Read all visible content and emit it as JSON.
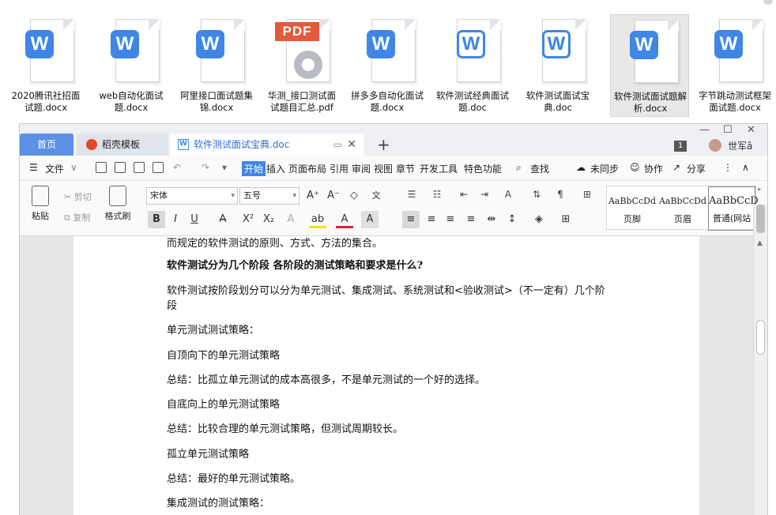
{
  "desktop_files": [
    {
      "label": "2020腾讯社招面试题.docx",
      "kind": "word"
    },
    {
      "label": "web自动化面试题.docx",
      "kind": "word"
    },
    {
      "label": "阿里接口面试题集锦.docx",
      "kind": "word"
    },
    {
      "label": "华测_接口测试面试题目汇总.pdf",
      "kind": "pdf",
      "badge": "PDF"
    },
    {
      "label": "拼多多自动化面试题.docx",
      "kind": "word"
    },
    {
      "label": "软件测试经典面试题.doc",
      "kind": "word-outline"
    },
    {
      "label": "软件测试面试宝典.doc",
      "kind": "word-outline"
    },
    {
      "label": "软件测试面试题解析.docx",
      "kind": "word",
      "selected": true
    },
    {
      "label": "字节跳动测试框架面试题.docx",
      "kind": "word"
    }
  ],
  "window": {
    "tabs": {
      "home": "首页",
      "template": "稻壳模板",
      "document": "软件测试面试宝典.doc"
    },
    "badge_count": "1",
    "user_name": "世军â"
  },
  "menubar": {
    "file": "文件",
    "items": [
      "开始",
      "插入",
      "页面布局",
      "引用",
      "审阅",
      "视图",
      "章节",
      "开发工具",
      "特色功能"
    ],
    "active": "开始",
    "search": "查找",
    "sync": "未同步",
    "collab": "协作",
    "share": "分享"
  },
  "ribbon": {
    "paste": "粘贴",
    "cut": "剪切",
    "copy": "复制",
    "format_painter": "格式刷",
    "font": "宋体",
    "size": "五号",
    "styles": [
      {
        "sample": "AaBbCcDd",
        "name": "页脚"
      },
      {
        "sample": "AaBbCcDd",
        "name": "页眉"
      },
      {
        "sample": "AaBbCcD",
        "name": "普通(网站"
      }
    ]
  },
  "document": {
    "lines": [
      {
        "text": "而规定的软件测试的原则、方式、方法的集合。",
        "style": "body"
      },
      {
        "text": "软件测试分为几个阶段  各阶段的测试策略和要求是什么?",
        "style": "heading"
      },
      {
        "text": "软件测试按阶段划分可以分为单元测试、集成测试、系统测试和<验收测试>（不一定有）几个阶段",
        "style": "wrap"
      },
      {
        "text": "单元测试测试策略：",
        "style": "body"
      },
      {
        "text": "自顶向下的单元测试策略",
        "style": "body"
      },
      {
        "text": "总结：比孤立单元测试的成本高很多，不是单元测试的一个好的选择。",
        "style": "body"
      },
      {
        "text": "自底向上的单元测试策略",
        "style": "body"
      },
      {
        "text": "总结：比较合理的单元测试策略，但测试周期较长。",
        "style": "body"
      },
      {
        "text": "孤立单元测试策略",
        "style": "body"
      },
      {
        "text": "总结：最好的单元测试策略。",
        "style": "body"
      },
      {
        "text": "集成测试的测试策略：",
        "style": "body"
      }
    ]
  },
  "colors": {
    "accent": "#3f86e6",
    "word_badge": "#3f86e6",
    "pdf_badge": "#e25a3b",
    "home_tab": "#5c90e5"
  }
}
